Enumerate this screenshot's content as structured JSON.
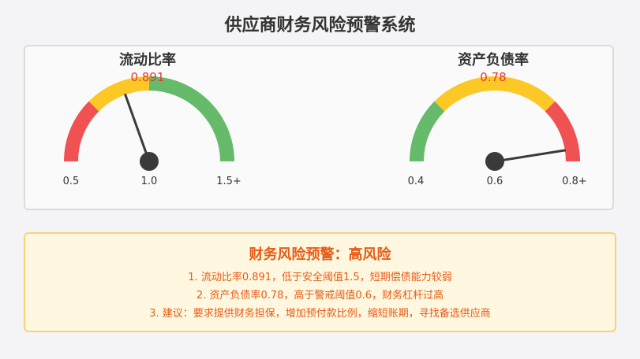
{
  "title": "供应商财务风险预警系统",
  "gauges": [
    {
      "name": "流动比率",
      "value": 0.891,
      "value_label": "0.891",
      "min": 0.5,
      "max": 1.5,
      "ticks": [
        "0.5",
        "1.0",
        "1.5+"
      ],
      "zones": [
        {
          "from": 0.5,
          "to": 0.75,
          "color": "#f05152"
        },
        {
          "from": 0.75,
          "to": 1.0,
          "color": "#fcc825"
        },
        {
          "from": 1.0,
          "to": 1.5,
          "color": "#66bb6a"
        }
      ]
    },
    {
      "name": "资产负债率",
      "value": 0.78,
      "value_label": "0.78",
      "min": 0.4,
      "max": 0.8,
      "ticks": [
        "0.4",
        "0.6",
        "0.8+"
      ],
      "zones": [
        {
          "from": 0.4,
          "to": 0.5,
          "color": "#66bb6a"
        },
        {
          "from": 0.5,
          "to": 0.7,
          "color": "#fcc825"
        },
        {
          "from": 0.7,
          "to": 0.8,
          "color": "#f05152"
        }
      ]
    }
  ],
  "warning": {
    "title": "财务风险预警：高风险",
    "items": [
      "1. 流动比率0.891，低于安全阈值1.5，短期偿债能力较弱",
      "2. 资产负债率0.78，高于警戒阈值0.6，财务杠杆过高",
      "3. 建议：要求提供财务担保，增加预付款比例，缩短账期，寻找备选供应商"
    ]
  },
  "colors": {
    "danger": "#f05152",
    "caution": "#fcc825",
    "safe": "#66bb6a",
    "needle": "#3a3a3a",
    "warning_text": "#e65c17"
  }
}
